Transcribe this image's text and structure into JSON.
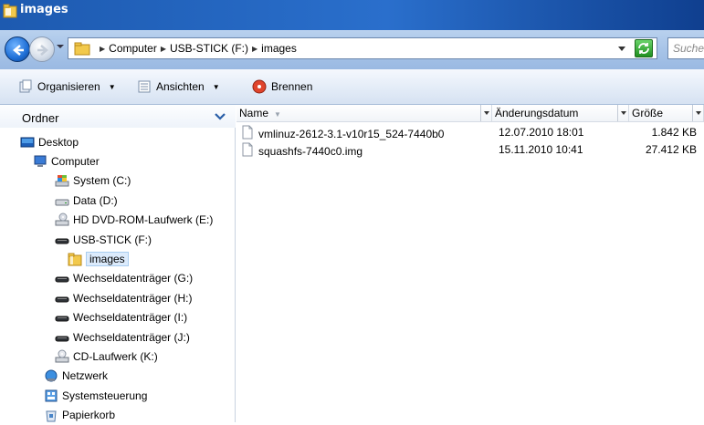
{
  "window": {
    "title": "images"
  },
  "address": {
    "crumbs": [
      "Computer",
      "USB-STICK (F:)",
      "images"
    ],
    "search_placeholder": "Suchen"
  },
  "toolbar": {
    "organize_label": "Organisieren",
    "views_label": "Ansichten",
    "burn_label": "Brennen"
  },
  "folders": {
    "header": "Ordner",
    "items": [
      {
        "label": "Desktop",
        "icon": "desktop-icon"
      },
      {
        "label": "Computer",
        "icon": "computer-icon"
      },
      {
        "label": "System (C:)",
        "icon": "system-drive-icon"
      },
      {
        "label": "Data (D:)",
        "icon": "hard-drive-icon"
      },
      {
        "label": "HD DVD-ROM-Laufwerk (E:)",
        "icon": "dvd-drive-icon"
      },
      {
        "label": "USB-STICK (F:)",
        "icon": "usb-drive-icon"
      },
      {
        "label": "images",
        "icon": "folder-icon",
        "selected": true
      },
      {
        "label": "Wechseldatenträger (G:)",
        "icon": "removable-drive-icon"
      },
      {
        "label": "Wechseldatenträger (H:)",
        "icon": "removable-drive-icon"
      },
      {
        "label": "Wechseldatenträger (I:)",
        "icon": "removable-drive-icon"
      },
      {
        "label": "Wechseldatenträger (J:)",
        "icon": "removable-drive-icon"
      },
      {
        "label": "CD-Laufwerk (K:)",
        "icon": "cd-drive-icon"
      },
      {
        "label": "Netzwerk",
        "icon": "network-icon"
      },
      {
        "label": "Systemsteuerung",
        "icon": "control-panel-icon"
      },
      {
        "label": "Papierkorb",
        "icon": "recycle-bin-icon"
      }
    ]
  },
  "columns": {
    "name": "Name",
    "date": "Änderungsdatum",
    "size": "Größe"
  },
  "files": [
    {
      "name": "vmlinuz-2612-3.1-v10r15_524-7440b0",
      "date": "12.07.2010 18:01",
      "size": "1.842 KB"
    },
    {
      "name": "squashfs-7440c0.img",
      "date": "15.11.2010 10:41",
      "size": "27.412 KB"
    }
  ]
}
